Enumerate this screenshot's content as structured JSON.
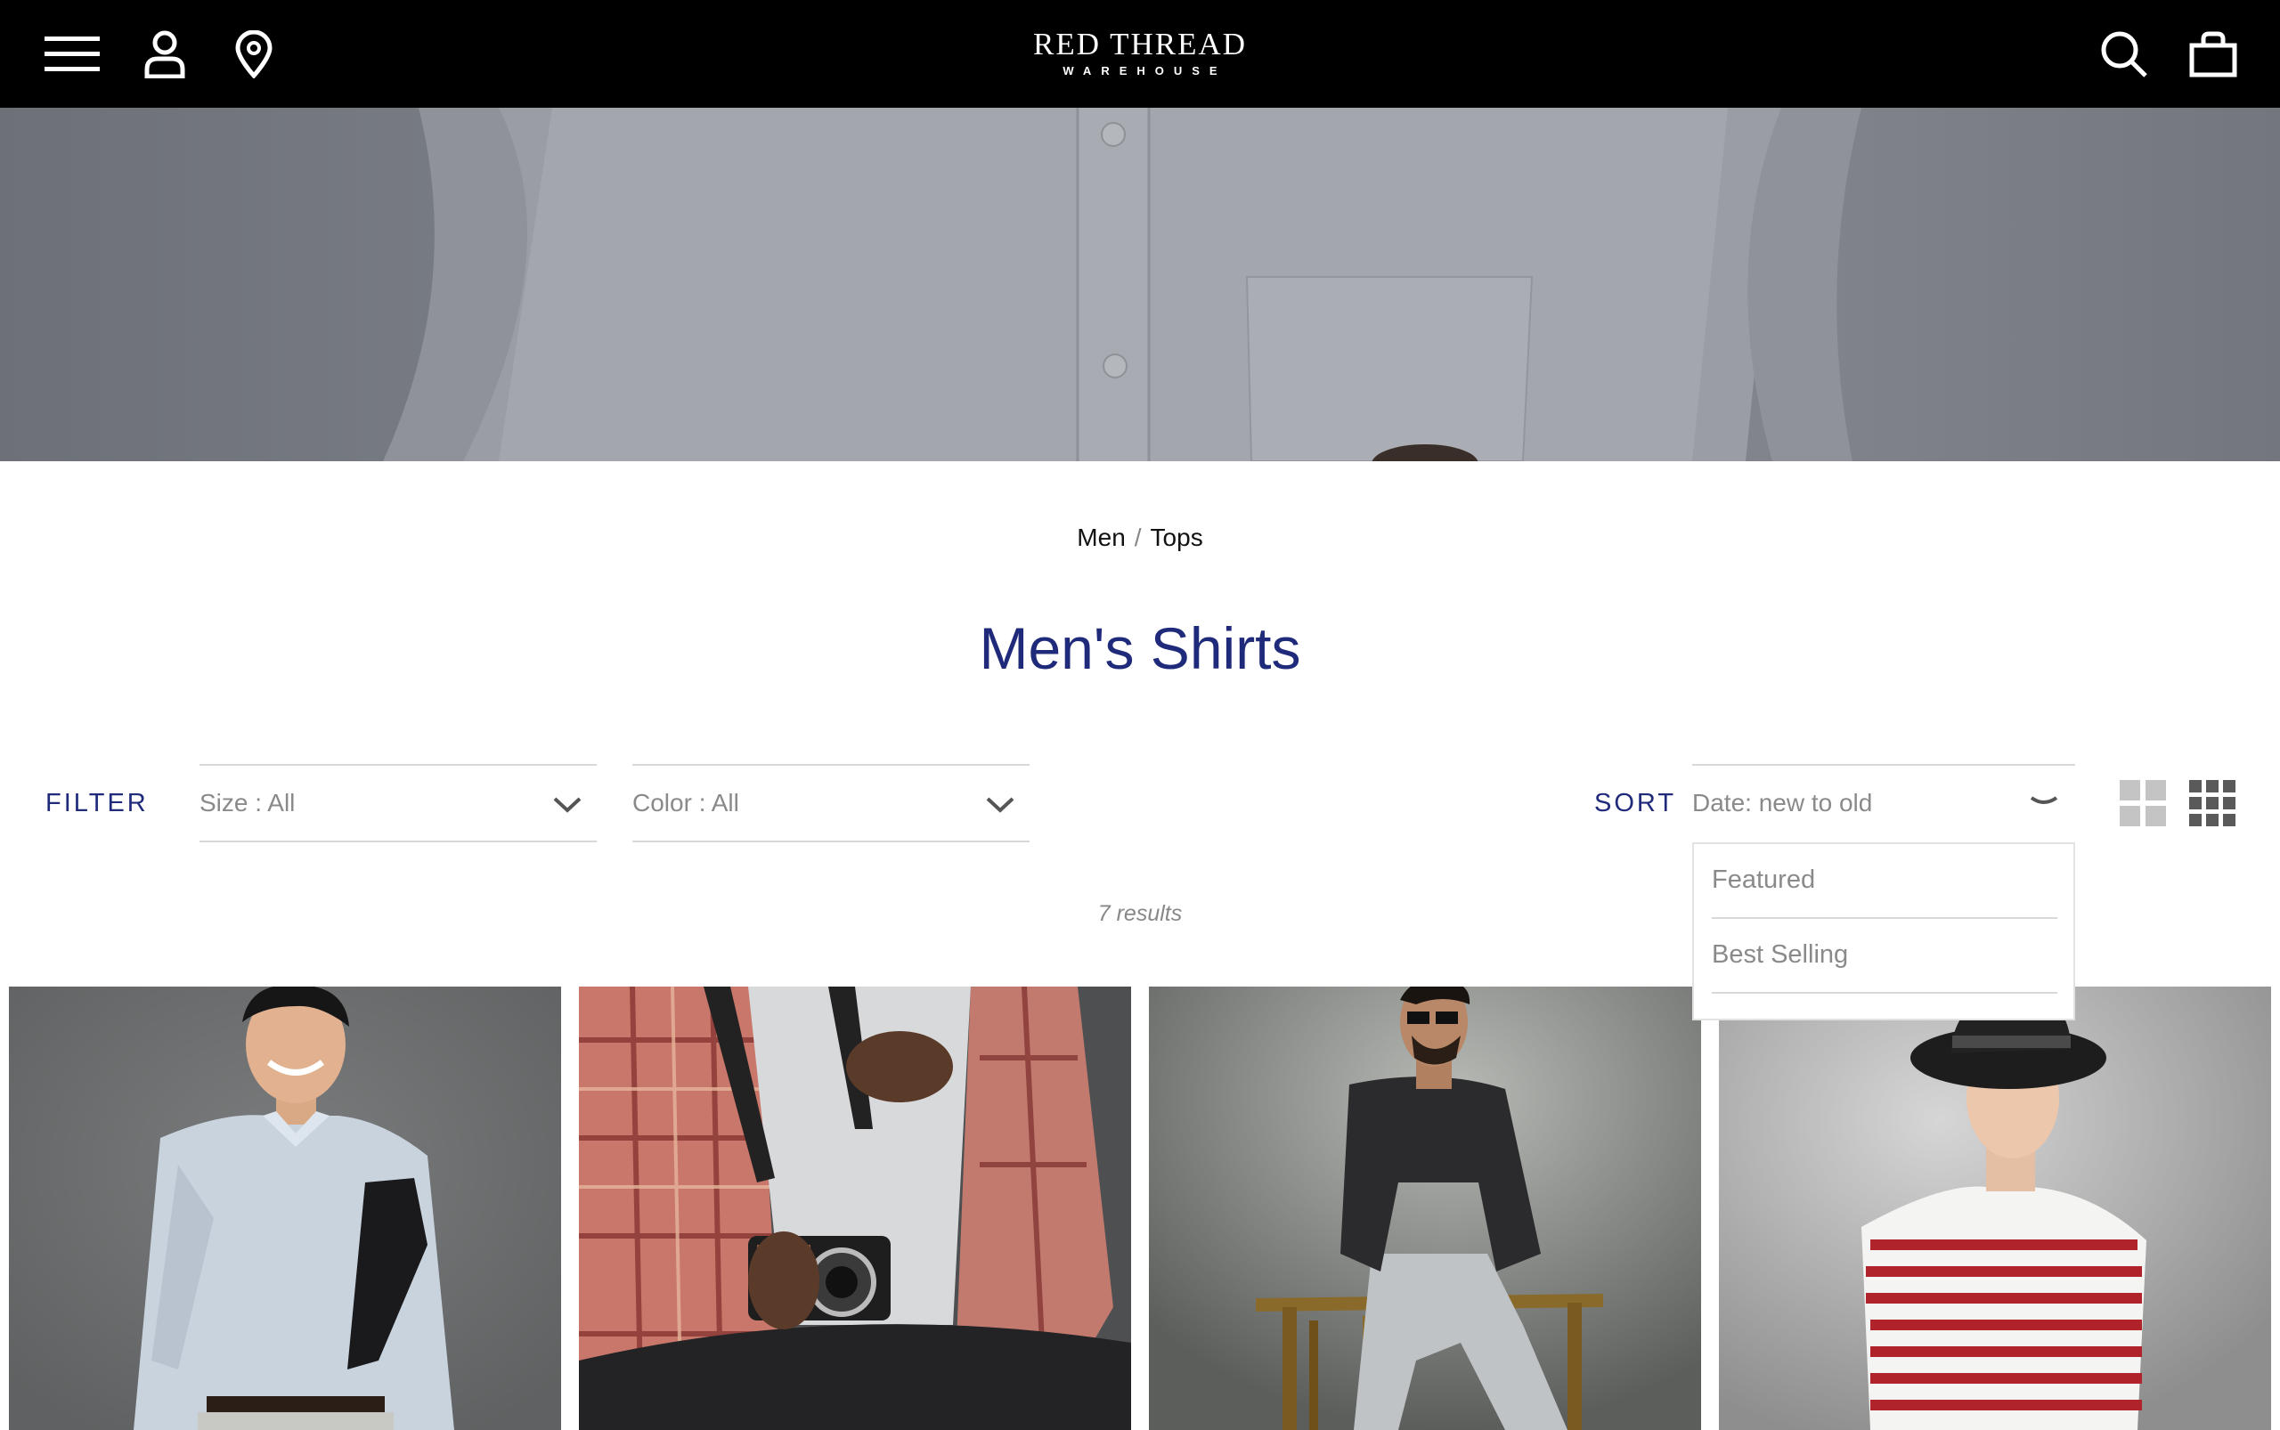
{
  "header": {
    "logo_main": "RED THREAD",
    "logo_sub": "WAREHOUSE",
    "icons": [
      "menu-icon",
      "user-icon",
      "location-pin-icon",
      "search-icon",
      "shopping-bag-icon"
    ]
  },
  "breadcrumb": {
    "items": [
      "Men",
      "Tops"
    ],
    "separator": "/"
  },
  "page": {
    "title": "Men's Shirts"
  },
  "filter": {
    "label": "FILTER",
    "size_value": "Size : All",
    "color_value": "Color : All"
  },
  "sort": {
    "label": "SORT",
    "value": "Date: new to old",
    "options": [
      "Featured",
      "Best Selling"
    ]
  },
  "results": {
    "text": "7 results"
  },
  "colors": {
    "header_bg": "#000000",
    "accent_navy": "#1f2a7a",
    "muted_text": "#8a8a8a",
    "divider": "#d8d8d8"
  }
}
